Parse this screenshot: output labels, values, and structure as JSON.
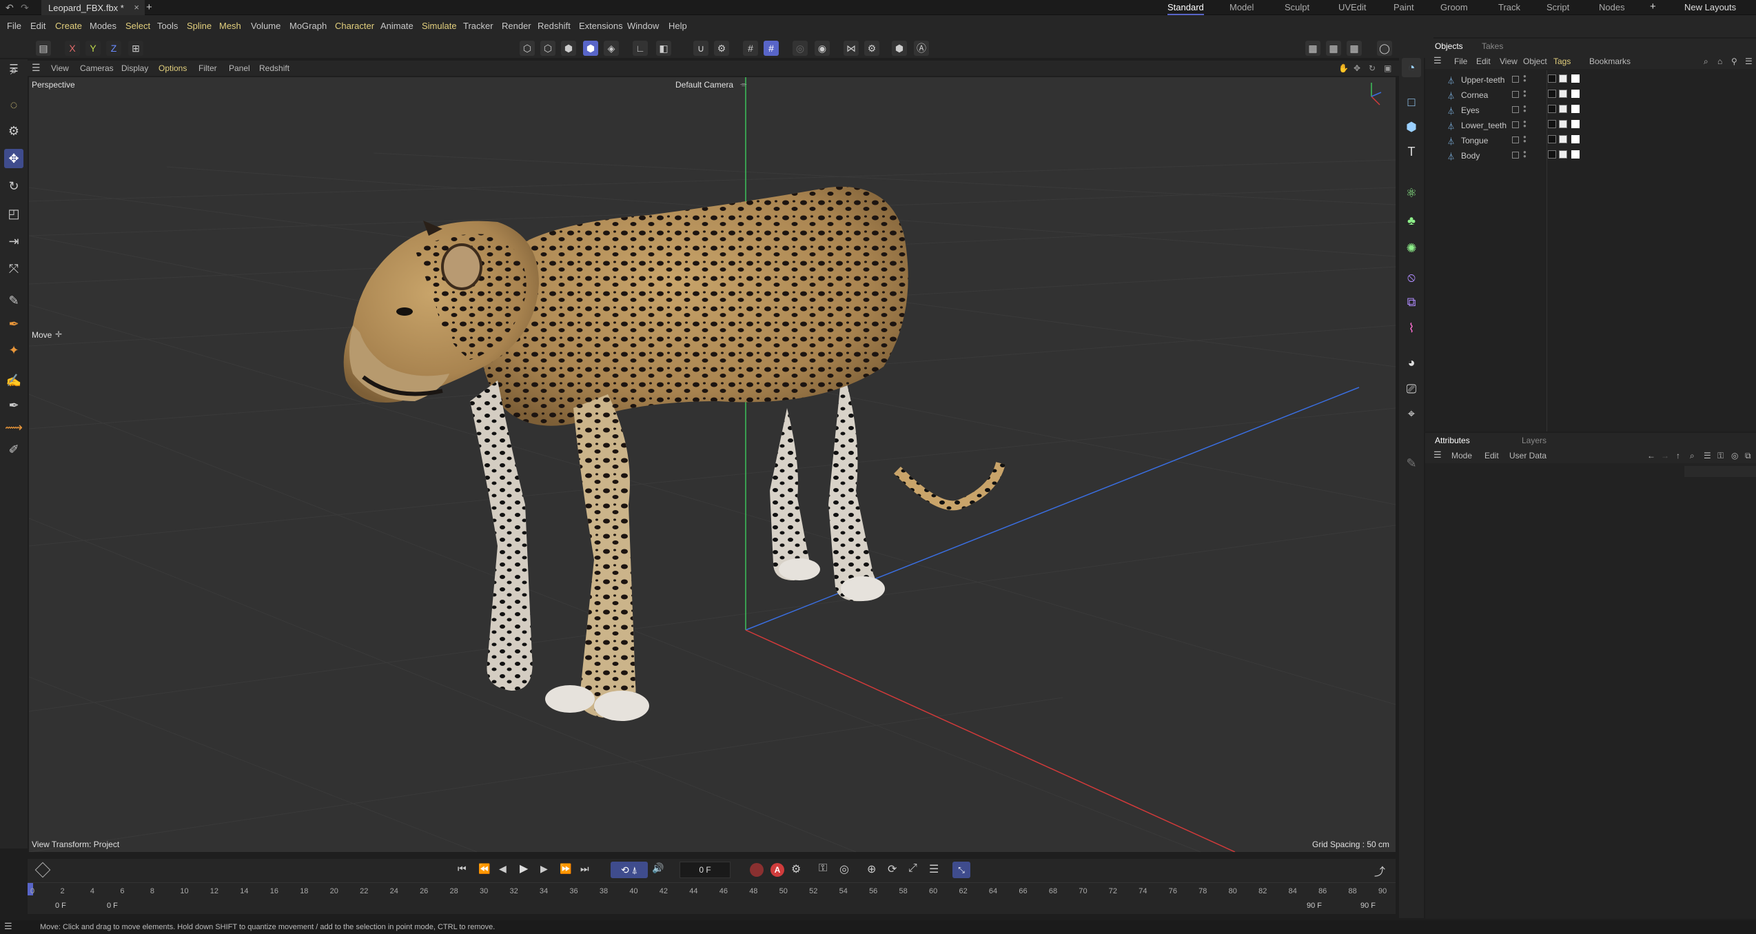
{
  "titlebar": {
    "tab_title": "Leopard_FBX.fbx *",
    "close_glyph": "×",
    "new_tab_glyph": "+",
    "layouts": [
      "Standard",
      "Model",
      "Sculpt",
      "UVEdit",
      "Paint",
      "Groom",
      "Track",
      "Script",
      "Nodes"
    ],
    "active_layout": "Standard",
    "add_layout_glyph": "+",
    "new_layouts": "New Layouts"
  },
  "menubar": {
    "items": [
      "File",
      "Edit",
      "Create",
      "Modes",
      "Select",
      "Tools",
      "Spline",
      "Mesh",
      "Volume",
      "MoGraph",
      "Character",
      "Animate",
      "Simulate",
      "Tracker",
      "Render",
      "Redshift",
      "Extensions",
      "Window",
      "Help"
    ]
  },
  "toolbar": {
    "axis_x": "X",
    "axis_y": "Y",
    "axis_z": "Z"
  },
  "viewport_menu": {
    "items": [
      "View",
      "Cameras",
      "Display",
      "Options",
      "Filter",
      "Panel",
      "Redshift"
    ]
  },
  "viewport": {
    "projection": "Perspective",
    "camera": "Default Camera",
    "camera_glyph": "⌯",
    "tool_label": "Move",
    "tool_glyph": "✛",
    "view_transform": "View Transform: Project",
    "grid_spacing": "Grid Spacing : 50 cm"
  },
  "timeline": {
    "current_frame": "0 F",
    "ticks": [
      "0",
      "2",
      "4",
      "6",
      "8",
      "10",
      "12",
      "14",
      "16",
      "18",
      "20",
      "22",
      "24",
      "26",
      "28",
      "30",
      "32",
      "34",
      "36",
      "38",
      "40",
      "42",
      "44",
      "46",
      "48",
      "50",
      "52",
      "54",
      "56",
      "58",
      "60",
      "62",
      "64",
      "66",
      "68",
      "70",
      "72",
      "74",
      "76",
      "78",
      "80",
      "82",
      "84",
      "86",
      "88",
      "90"
    ],
    "start_field": "0 F",
    "min_field": "0 F",
    "end_field": "90 F",
    "max_field": "90 F"
  },
  "objects_panel": {
    "tabs": [
      "Objects",
      "Takes"
    ],
    "menu": [
      "File",
      "Edit",
      "View",
      "Object",
      "Tags",
      "Bookmarks"
    ],
    "items": [
      "Upper-teeth",
      "Cornea",
      "Eyes",
      "Lower_teeth",
      "Tongue",
      "Body"
    ]
  },
  "attributes_panel": {
    "tabs": [
      "Attributes",
      "Layers"
    ],
    "menu": [
      "Mode",
      "Edit",
      "User Data"
    ]
  },
  "status": {
    "message": "Move: Click and drag to move elements. Hold down SHIFT to quantize movement / add to the selection in point mode, CTRL to remove."
  },
  "colors": {
    "accent": "#5865c8",
    "highlight_menu": "#e2cf7d",
    "axis_x": "#d23a3a",
    "axis_y": "#3dc25a",
    "axis_z": "#3a6ee0"
  }
}
